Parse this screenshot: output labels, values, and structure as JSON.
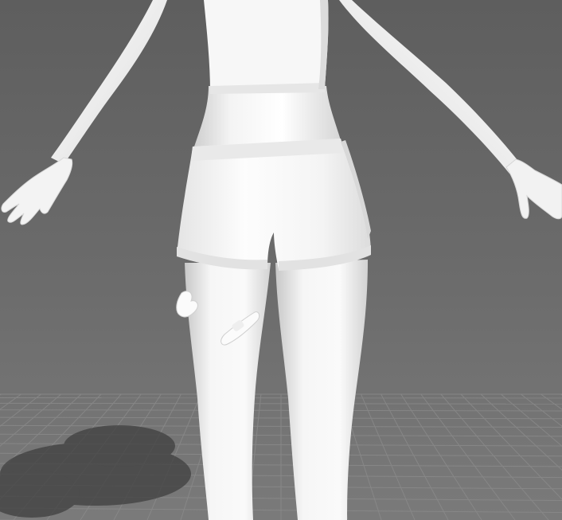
{
  "viewport": {
    "background_top": "#5e5e5e",
    "background_bottom": "#7a7a7a",
    "grid_color": "#8a8a8a",
    "shadow_color": "#3e3e3e"
  },
  "model": {
    "skin_color": "#f2f2f2",
    "clothing_color": "#ffffff",
    "shade_color": "#d4d4d4",
    "bandage_color": "#fbfbfb",
    "parts": [
      "top",
      "torso",
      "left-arm",
      "right-arm",
      "shorts",
      "left-leg",
      "right-leg",
      "bandage-upper",
      "bandage-lower"
    ]
  }
}
